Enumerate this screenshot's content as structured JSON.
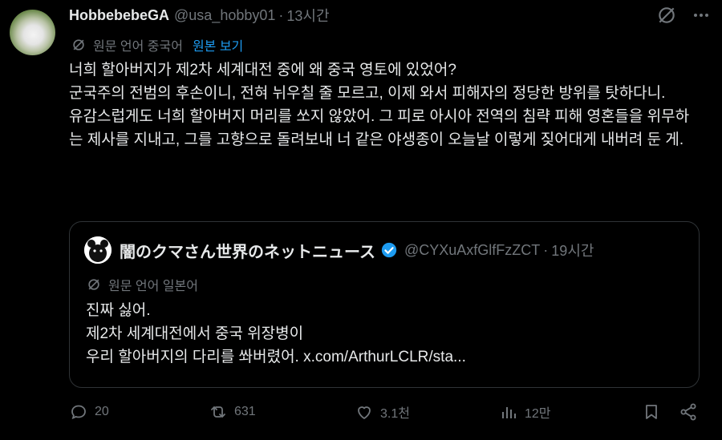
{
  "tweet": {
    "author_name": "HobbebebeGA",
    "author_handle": "@usa_hobby01",
    "separator": "·",
    "timestamp": "13시간",
    "translate_label": "원문 언어 중국어",
    "show_original": "원본 보기",
    "body": [
      "너희 할아버지가 제2차 세계대전 중에 왜 중국 영토에 있었어?",
      "군국주의 전범의 후손이니, 전혀 뉘우칠 줄 모르고, 이제 와서 피해자의 정당한 방위를 탓하다니.",
      "유감스럽게도 너희 할아버지 머리를 쏘지 않았어. 그 피로 아시아 전역의 침략 피해 영혼들을 위무하는 제사를 지내고, 그를 고향으로 돌려보내 너 같은 야생종이 오늘날 이렇게 짖어대게 내버려 둔 게."
    ]
  },
  "quoted": {
    "author_name": "闇のクマさん世界のネットニュース",
    "author_handle": "@CYXuAxfGlfFzZCT",
    "separator": "·",
    "timestamp": "19시간",
    "translate_label": "원문 언어 일본어",
    "body": [
      "진짜 싫어.",
      "제2차 세계대전에서 중국 위장병이",
      "우리 할아버지의 다리를 쏴버렸어. x.com/ArthurLCLR/sta..."
    ]
  },
  "actions": {
    "replies": "20",
    "retweets": "631",
    "likes": "3.1천",
    "views": "12만"
  },
  "icons": {
    "grok": "grok-icon",
    "more": "more-icon",
    "translate": "translate-icon",
    "verified": "verified-badge-icon",
    "reply": "reply-icon",
    "retweet": "retweet-icon",
    "like": "like-icon",
    "views": "views-icon",
    "bookmark": "bookmark-icon",
    "share": "share-icon"
  },
  "colors": {
    "background": "#000000",
    "text": "#e7e9ea",
    "muted": "#71767b",
    "accent": "#1d9bf0",
    "border": "#2f3336"
  }
}
